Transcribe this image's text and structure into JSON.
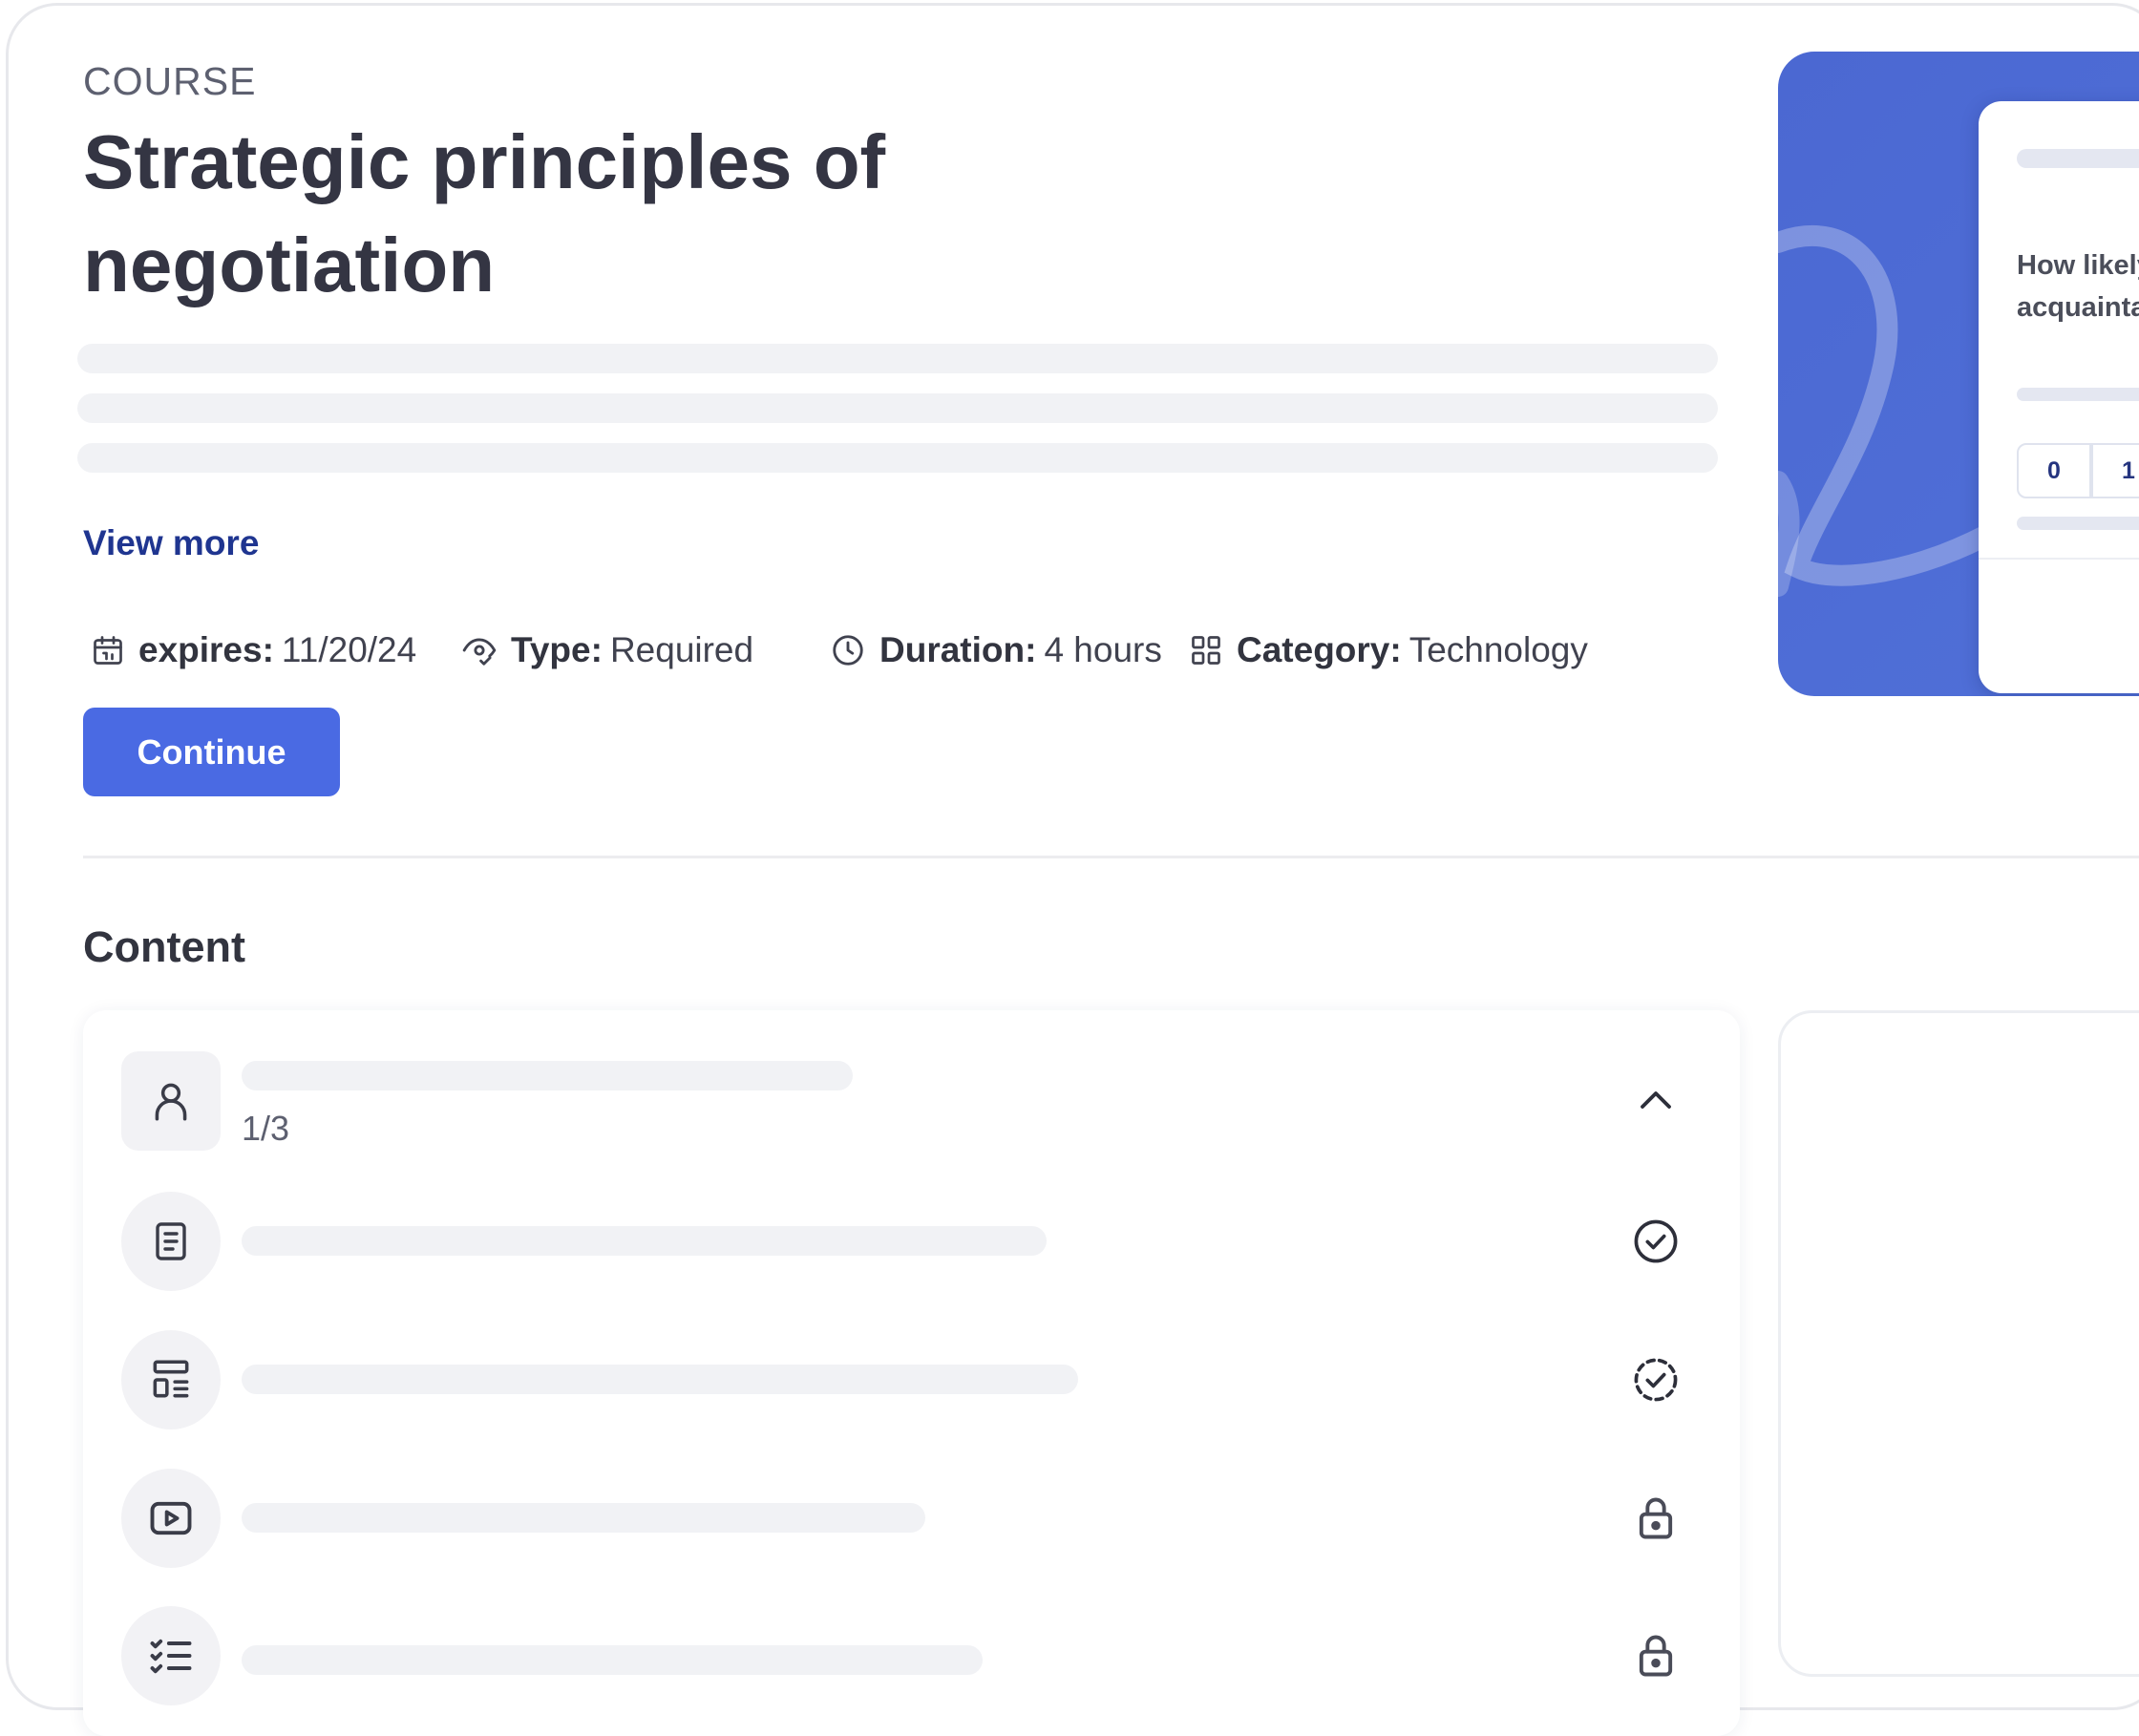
{
  "course": {
    "kicker": "COURSE",
    "title": "Strategic principles of negotiation",
    "view_more": "View more",
    "continue_label": "Continue"
  },
  "meta": [
    {
      "icon": "calendar-icon",
      "label": "expires:",
      "value": "11/20/24"
    },
    {
      "icon": "eye-check-icon",
      "label": "Type:",
      "value": "Required"
    },
    {
      "icon": "clock-icon",
      "label": "Duration:",
      "value": "4 hours"
    },
    {
      "icon": "grid-icon",
      "label": "Category:",
      "value": "Technology"
    }
  ],
  "hero": {
    "question": "How likely\nacquainta",
    "scale": [
      "0",
      "1"
    ],
    "accent": "#4b68d2"
  },
  "content": {
    "title": "Content",
    "module": {
      "icon": "person-icon",
      "progress": "1/3",
      "toggle": "chevron-up-icon"
    },
    "items": [
      {
        "icon": "document-icon",
        "status": "check-circle-icon"
      },
      {
        "icon": "layout-icon",
        "status": "check-circle-dashed-icon"
      },
      {
        "icon": "video-icon",
        "status": "lock-icon"
      },
      {
        "icon": "checklist-icon",
        "status": "lock-icon"
      }
    ]
  },
  "colors": {
    "primary_button": "#4a6ae3",
    "link": "#1f3590",
    "skeleton": "#f1f2f5"
  }
}
